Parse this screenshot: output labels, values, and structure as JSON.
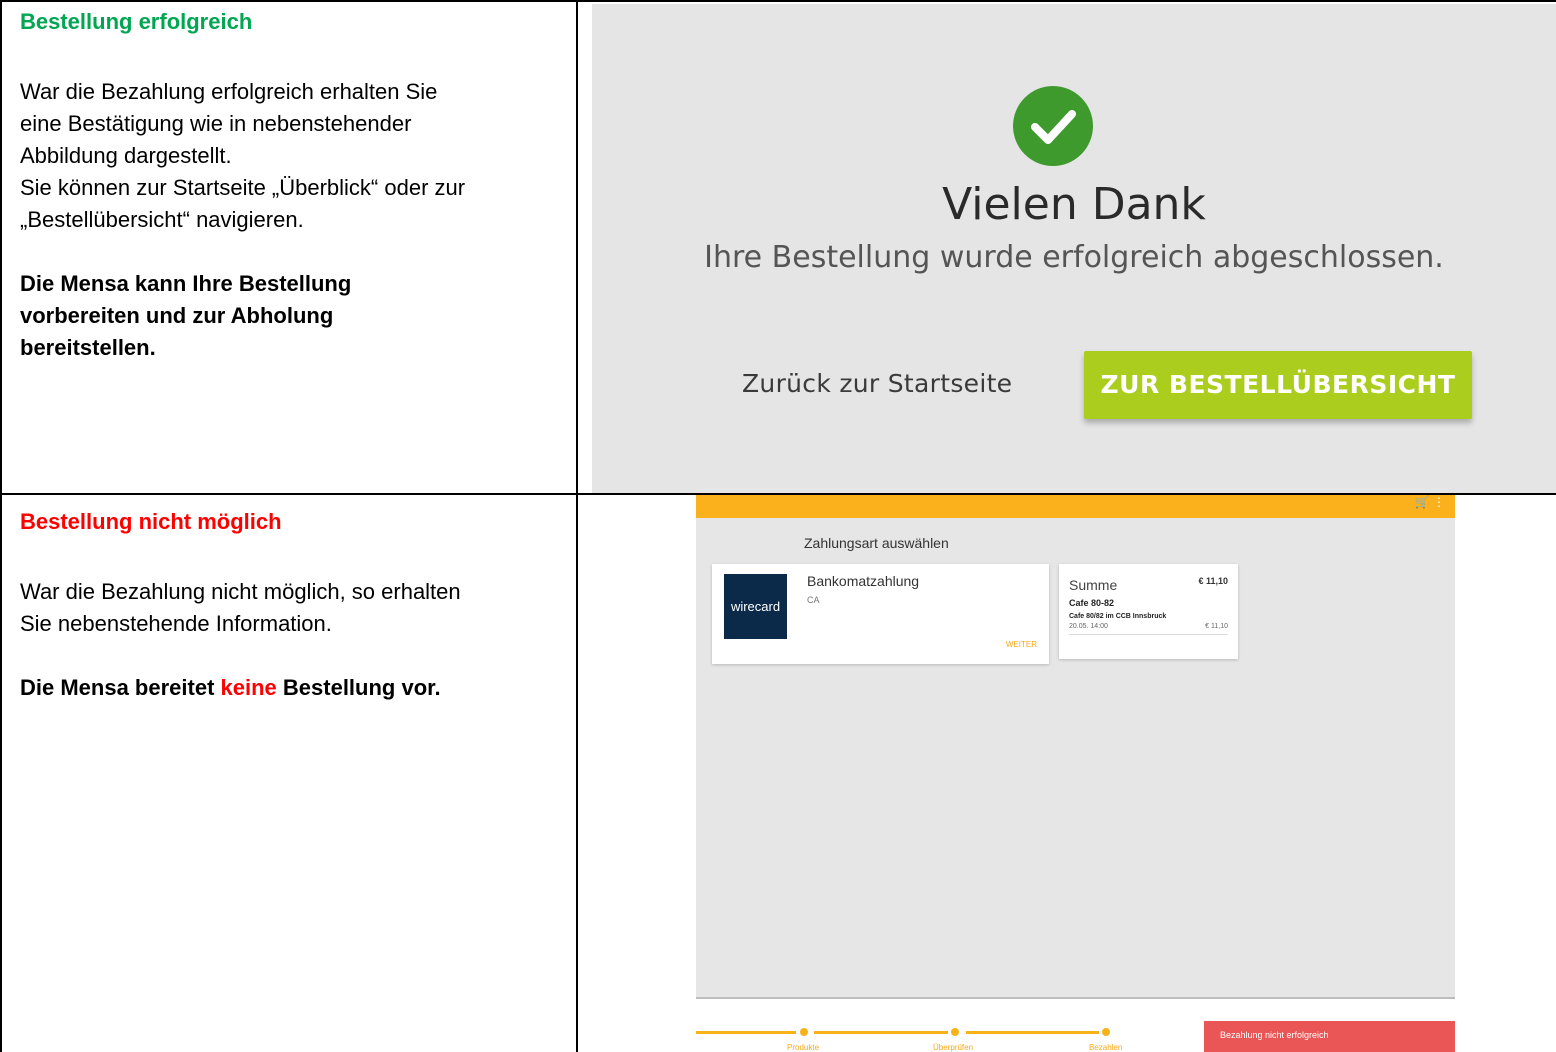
{
  "row1": {
    "heading": "Bestellung erfolgreich",
    "para_lines": [
      "War die Bezahlung erfolgreich erhalten Sie",
      "eine Bestätigung wie in nebenstehender",
      "Abbildung dargestellt.",
      "Sie können zur Startseite „Überblick“ oder zur",
      "„Bestellübersicht“ navigieren."
    ],
    "bold_lines": [
      "Die Mensa kann Ihre Bestellung",
      "vorbereiten und zur Abholung",
      "bereitstellen."
    ]
  },
  "row2": {
    "heading": "Bestellung nicht möglich",
    "para_lines": [
      "War die Bezahlung nicht möglich, so erhalten",
      "Sie nebenstehende Information."
    ],
    "bold_prefix": "Die Mensa bereitet ",
    "bold_red": "keine",
    "bold_suffix": " Bestellung vor."
  },
  "success_screen": {
    "title": "Vielen Dank",
    "subtitle": "Ihre Bestellung wurde erfolgreich abgeschlossen.",
    "back_link": "Zurück zur Startseite",
    "overview_button": "ZUR BESTELLÜBERSICHT",
    "icon": "check-circle-icon",
    "accent_color": "#aacd1e"
  },
  "payment_screen": {
    "title": "Zahlungsart auswählen",
    "method": {
      "logo": "wirecard",
      "name": "Bankomatzahlung",
      "sub": "CA",
      "action": "WEITER"
    },
    "summary": {
      "label": "Summe",
      "total": "€ 11,10",
      "shop": "Cafe 80-82",
      "location": "Cafe 80/82 im CCB Innsbruck",
      "date": "20.05. 14:00",
      "price": "€ 11,10"
    },
    "steps": [
      "Produkte",
      "Überprüfen",
      "Bezahlen"
    ],
    "error": "Bezahlung nicht erfolgreich",
    "accent_color": "#fbb11c"
  }
}
